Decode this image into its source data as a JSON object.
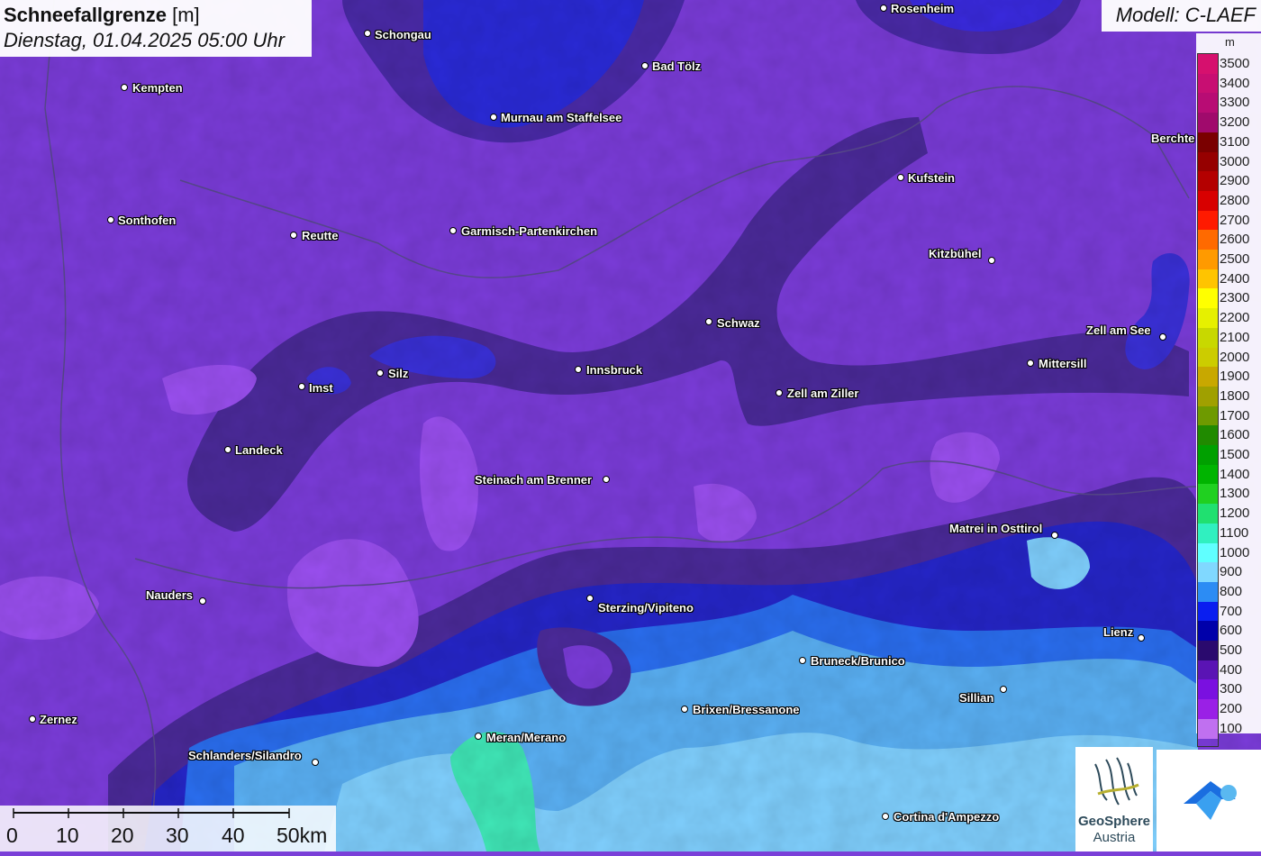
{
  "title": {
    "main": "Schneefallgrenze",
    "unit": "[m]",
    "datetime": "Dienstag, 01.04.2025 05:00 Uhr"
  },
  "model": "Modell: C-LAEF",
  "legend": {
    "unit": "m",
    "steps": [
      {
        "label": "3500",
        "color": "#d6106e"
      },
      {
        "label": "3400",
        "color": "#c80e72"
      },
      {
        "label": "3300",
        "color": "#b80c74"
      },
      {
        "label": "3200",
        "color": "#a00a6c"
      },
      {
        "label": "3100",
        "color": "#7a0000"
      },
      {
        "label": "3000",
        "color": "#960000"
      },
      {
        "label": "2900",
        "color": "#b40000"
      },
      {
        "label": "2800",
        "color": "#d80000"
      },
      {
        "label": "2700",
        "color": "#ff1a00"
      },
      {
        "label": "2600",
        "color": "#ff6a00"
      },
      {
        "label": "2500",
        "color": "#ff9a00"
      },
      {
        "label": "2400",
        "color": "#ffc400"
      },
      {
        "label": "2300",
        "color": "#ffff00"
      },
      {
        "label": "2200",
        "color": "#e6f000"
      },
      {
        "label": "2100",
        "color": "#c8d800"
      },
      {
        "label": "2000",
        "color": "#cccc00"
      },
      {
        "label": "1900",
        "color": "#c8a800"
      },
      {
        "label": "1800",
        "color": "#a0a000"
      },
      {
        "label": "1700",
        "color": "#6e9a00"
      },
      {
        "label": "1600",
        "color": "#208a00"
      },
      {
        "label": "1500",
        "color": "#00a000"
      },
      {
        "label": "1400",
        "color": "#00b400"
      },
      {
        "label": "1300",
        "color": "#20d020"
      },
      {
        "label": "1200",
        "color": "#20e070"
      },
      {
        "label": "1100",
        "color": "#30f0c0"
      },
      {
        "label": "1000",
        "color": "#60ffff"
      },
      {
        "label": "900",
        "color": "#80d8ff"
      },
      {
        "label": "800",
        "color": "#2c8cf4"
      },
      {
        "label": "700",
        "color": "#0a1ef0"
      },
      {
        "label": "600",
        "color": "#0000aa"
      },
      {
        "label": "500",
        "color": "#2a0a6e"
      },
      {
        "label": "400",
        "color": "#5a14b4"
      },
      {
        "label": "300",
        "color": "#7a10e0"
      },
      {
        "label": "200",
        "color": "#9a20e6"
      },
      {
        "label": "100",
        "color": "#c070f0"
      }
    ]
  },
  "scalebar": {
    "labels": [
      "0",
      "10",
      "20",
      "30",
      "40",
      "50km"
    ]
  },
  "logos": {
    "geosphere_line1": "GeoSphere",
    "geosphere_line2": "Austria"
  },
  "cities": [
    {
      "name": "Schongau"
    },
    {
      "name": "Rosenheim"
    },
    {
      "name": "Kempten"
    },
    {
      "name": "Bad Tölz"
    },
    {
      "name": "Murnau am Staffelsee"
    },
    {
      "name": "Berchte"
    },
    {
      "name": "Kufstein"
    },
    {
      "name": "Sonthofen"
    },
    {
      "name": "Reutte"
    },
    {
      "name": "Garmisch-Partenkirchen"
    },
    {
      "name": "Kitzbühel"
    },
    {
      "name": "Schwaz"
    },
    {
      "name": "Zell am See"
    },
    {
      "name": "Mittersill"
    },
    {
      "name": "Innsbruck"
    },
    {
      "name": "Imst"
    },
    {
      "name": "Silz"
    },
    {
      "name": "Zell am Ziller"
    },
    {
      "name": "Landeck"
    },
    {
      "name": "Steinach am Brenner"
    },
    {
      "name": "Matrei in Osttirol"
    },
    {
      "name": "Nauders"
    },
    {
      "name": "Sterzing/Vipiteno"
    },
    {
      "name": "Lienz"
    },
    {
      "name": "Bruneck/Brunico"
    },
    {
      "name": "Sillian"
    },
    {
      "name": "Brixen/Bressanone"
    },
    {
      "name": "Zernez"
    },
    {
      "name": "Meran/Merano"
    },
    {
      "name": "Schlanders/Silandro"
    },
    {
      "name": "Cortina d'Ampezzo"
    }
  ]
}
